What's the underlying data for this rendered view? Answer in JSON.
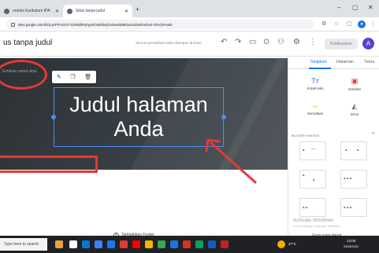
{
  "browser": {
    "tabs": [
      {
        "label": "onteks Kurikulum IPA",
        "active": false
      },
      {
        "label": "Situs tanpa judul",
        "active": true
      }
    ],
    "new_tab": "+",
    "url": "sites.google.com/d/11oyzP/Fe11OY1ZNNdkPy0yy3rOuk0bu/p/16ow2E8BUw244ZedO4GvS-OKVQtYuubt",
    "window_controls": {
      "minimize": "–",
      "maximize": "▢",
      "close": "✕"
    }
  },
  "sites_toolbar": {
    "doc_title": "us tanpa judul",
    "saved_status": "Semua perubahan telah disimpan di Drive",
    "publish_label": "Publikasikan",
    "avatar_letter": "A"
  },
  "canvas": {
    "site_name_placeholder": "Entrikan nama situs",
    "page_title_line1": "Judul halaman",
    "page_title_line2": "Anda",
    "add_footer_label": "Tambahkan Footer"
  },
  "panel": {
    "tabs": [
      "Sisipkan",
      "Halaman",
      "Tema"
    ],
    "insert_items": [
      {
        "label": "Kotak teks",
        "icon": "text-box-icon"
      },
      {
        "label": "Gambar",
        "icon": "image-icon"
      },
      {
        "label": "Sematkan",
        "icon": "embed-icon"
      },
      {
        "label": "Drive",
        "icon": "drive-icon"
      }
    ],
    "section_label": "BLOKIR KONTEN",
    "watermark_title": "Activate Windows",
    "watermark_sub": "Go to Settings to activate Windows.",
    "collapsible_group": "Grup yang dapat"
  },
  "taskbar": {
    "search_label": "Type here to search",
    "weather": "27°C",
    "time": "13:00",
    "date": "03/08/2022"
  },
  "colors": {
    "accent": "#1a73e8",
    "selection": "#4a8cf7",
    "annotation": "#e53935",
    "header_bg": "#394045"
  }
}
